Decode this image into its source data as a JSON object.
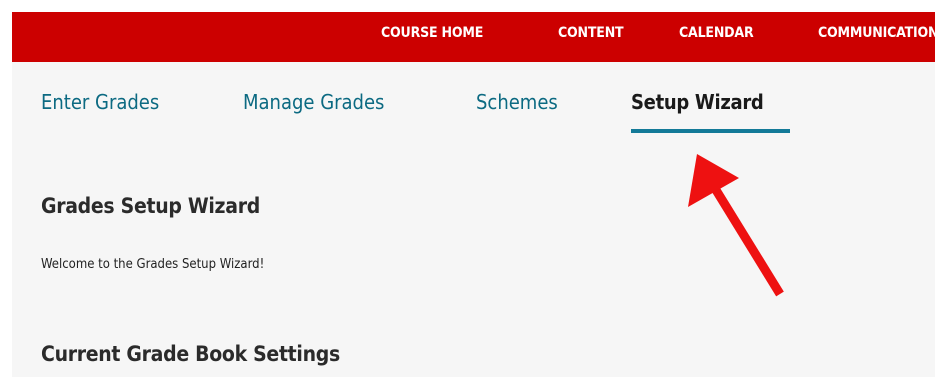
{
  "topnav": {
    "items": [
      {
        "label": "COURSE HOME"
      },
      {
        "label": "CONTENT"
      },
      {
        "label": "CALENDAR"
      },
      {
        "label": "COMMUNICATION"
      }
    ]
  },
  "tabs": [
    {
      "label": "Enter Grades",
      "active": false
    },
    {
      "label": "Manage Grades",
      "active": false
    },
    {
      "label": "Schemes",
      "active": false
    },
    {
      "label": "Setup Wizard",
      "active": true
    }
  ],
  "main": {
    "title": "Grades Setup Wizard",
    "welcome": "Welcome to the Grades Setup Wizard!",
    "section_title": "Current Grade Book Settings"
  },
  "colors": {
    "brand_bar": "#cc0000",
    "tab_link": "#0c6a82",
    "active_underline": "#137a98",
    "annotation_arrow": "#ee1111"
  }
}
